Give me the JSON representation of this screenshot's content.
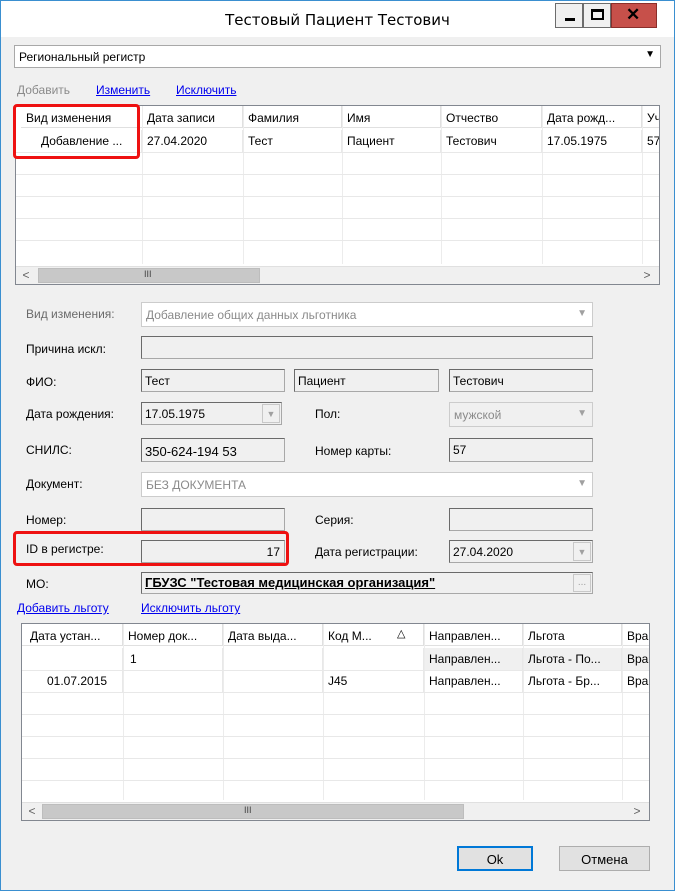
{
  "window": {
    "title": "Тестовый Пациент Тестович"
  },
  "register_select": {
    "value": "Региональный регистр"
  },
  "toolbar": {
    "add": "Добавить",
    "edit": "Изменить",
    "exclude": "Исключить"
  },
  "top_grid": {
    "columns": [
      "Вид изменения",
      "Дата записи",
      "Фамилия",
      "Имя",
      "Отчество",
      "Дата рожд...",
      "Уч"
    ],
    "rows": [
      [
        "Добавление ...",
        "27.04.2020",
        "Тест",
        "Пациент",
        "Тестович",
        "17.05.1975",
        "57"
      ]
    ]
  },
  "form": {
    "change_type_label": "Вид изменения:",
    "change_type_value": "Добавление общих данных льготника",
    "reason_label": "Причина искл:",
    "reason_value": "",
    "fio_label": "ФИО:",
    "last_name": "Тест",
    "first_name": "Пациент",
    "middle_name": "Тестович",
    "birth_label": "Дата рождения:",
    "birth_value": "17.05.1975",
    "sex_label": "Пол:",
    "sex_value": "мужской",
    "snils_label": "СНИЛС:",
    "snils_value": "350-624-194 53",
    "card_label": "Номер карты:",
    "card_value": "57",
    "doc_label": "Документ:",
    "doc_value": "БЕЗ ДОКУМЕНТА",
    "number_label": "Номер:",
    "number_value": "",
    "series_label": "Серия:",
    "series_value": "",
    "id_label": "ID в регистре:",
    "id_value": "17",
    "regdate_label": "Дата регистрации:",
    "regdate_value": "27.04.2020",
    "mo_label": "МО:",
    "mo_value": "ГБУЗС \"Тестовая медицинская организация\"",
    "mo_button": "..."
  },
  "benefit_links": {
    "add": "Добавить льготу",
    "exclude": "Исключить льготу"
  },
  "bottom_grid": {
    "columns": [
      "Дата устан...",
      "Номер док...",
      "Дата выда...",
      "Код М...",
      "Направлен...",
      "Льгота",
      "Вра"
    ],
    "rows": [
      [
        "",
        "1",
        "",
        "",
        "Направлен...",
        "Льгота - По...",
        "Вра"
      ],
      [
        "01.07.2015",
        "",
        "",
        "J45",
        "Направлен...",
        "Льгота - Бр...",
        "Вра"
      ]
    ]
  },
  "buttons": {
    "ok": "Ok",
    "cancel": "Отмена"
  }
}
